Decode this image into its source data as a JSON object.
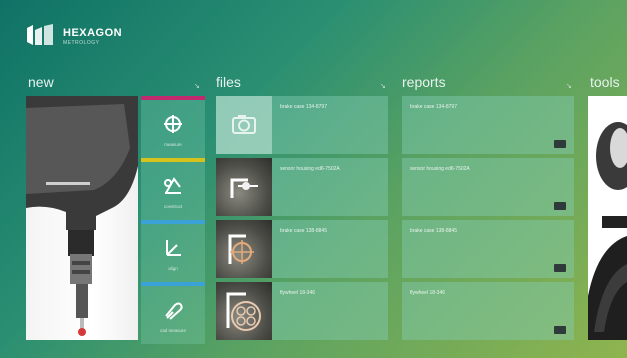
{
  "brand": {
    "name": "HEXAGON",
    "subtitle": "METROLOGY"
  },
  "sections": {
    "new": "new",
    "files": "files",
    "reports": "reports",
    "tools": "tools"
  },
  "new_tools": [
    {
      "label": "measure",
      "icon": "crosshair-icon"
    },
    {
      "label": "construct",
      "icon": "construct-icon"
    },
    {
      "label": "align",
      "icon": "align-icon"
    },
    {
      "label": "cad measure",
      "icon": "cad-measure-icon"
    }
  ],
  "files": [
    {
      "name": "brake case 134-8797"
    },
    {
      "name": "sensor housing ed6-7502A"
    },
    {
      "name": "brake case 138-8845"
    },
    {
      "name": "flywheel 18-346"
    }
  ],
  "reports": [
    {
      "name": "brake case 134-8797"
    },
    {
      "name": "sensor housing ed6-7502A"
    },
    {
      "name": "brake case 138-8845"
    },
    {
      "name": "flywheel 18-346"
    }
  ],
  "colors": {
    "bg_start": "#0f7266",
    "bg_end": "#8fb44e",
    "tile": "#82cdb4",
    "tool_accent": "#d6a21c"
  }
}
